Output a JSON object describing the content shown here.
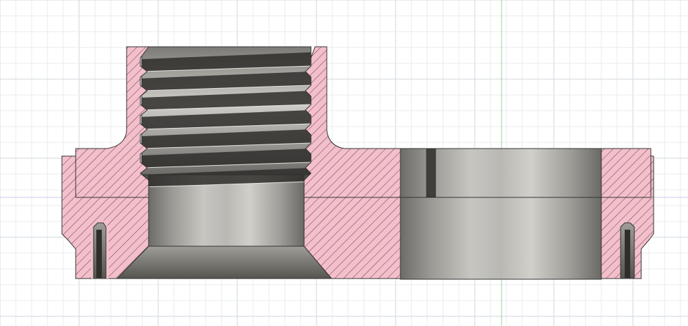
{
  "view": {
    "type": "section-view",
    "background": "#ffffff",
    "grid_minor_color": "#e7ebef",
    "grid_major_color": "#cfd6dd",
    "axis_vertical_color": "#a6dca6",
    "axis_horizontal_color": "#c9c9ee"
  },
  "colors": {
    "hatch_fill": "#f3bfcb",
    "hatch_line": "#5a3b43",
    "outline": "#333333",
    "metal_dark": "#5f5e5a",
    "metal_mid": "#8e8d88",
    "metal_light": "#c9c8c3",
    "cavity": "#3a3a38"
  },
  "features": {
    "threaded_bore": "thread",
    "thread_turns": 7,
    "counterbore": "chamfered-bore",
    "side_slot": "slot",
    "left_seal_groove": "groove",
    "right_seal_groove": "groove"
  }
}
